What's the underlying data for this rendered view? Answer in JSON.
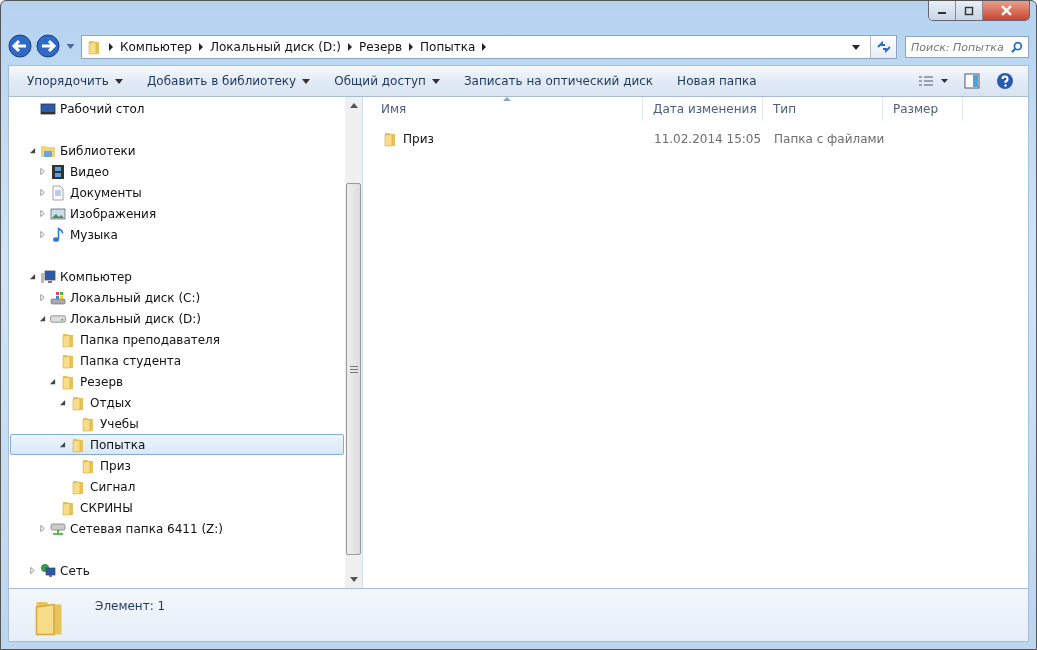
{
  "address_bar": {
    "path": [
      "Компьютер",
      "Локальный диск (D:)",
      "Резерв",
      "Попытка"
    ]
  },
  "search": {
    "placeholder": "Поиск: Попытка"
  },
  "toolbar": {
    "buttons": [
      {
        "label": "Упорядочить",
        "dropdown": true
      },
      {
        "label": "Добавить в библиотеку",
        "dropdown": true
      },
      {
        "label": "Общий доступ",
        "dropdown": true
      },
      {
        "label": "Записать на оптический диск",
        "dropdown": false
      },
      {
        "label": "Новая папка",
        "dropdown": false
      }
    ]
  },
  "sidebar": {
    "groups": [
      {
        "items": [
          {
            "label": "Рабочий стол",
            "kind": "desktop",
            "selected": false
          }
        ]
      },
      {
        "items": [
          {
            "label": "Библиотеки",
            "kind": "library",
            "expanded": true,
            "selected": false,
            "children": [
              {
                "label": "Видео",
                "kind": "video",
                "expanded": false,
                "selected": false
              },
              {
                "label": "Документы",
                "kind": "document",
                "expanded": false,
                "selected": false
              },
              {
                "label": "Изображения",
                "kind": "image",
                "expanded": false,
                "selected": false
              },
              {
                "label": "Музыка",
                "kind": "music",
                "expanded": false,
                "selected": false
              }
            ]
          }
        ]
      },
      {
        "items": [
          {
            "label": "Компьютер",
            "kind": "computer",
            "expanded": true,
            "selected": false,
            "children": [
              {
                "label": "Локальный диск (C:)",
                "kind": "system-drive",
                "expanded": false,
                "selected": false
              },
              {
                "label": "Локальный диск (D:)",
                "kind": "drive",
                "expanded": true,
                "selected": false,
                "children": [
                  {
                    "label": "Папка преподавателя",
                    "kind": "folder",
                    "selected": false
                  },
                  {
                    "label": "Папка студента",
                    "kind": "folder",
                    "selected": false
                  },
                  {
                    "label": "Резерв",
                    "kind": "folder",
                    "expanded": true,
                    "selected": false,
                    "children": [
                      {
                        "label": "Отдых",
                        "kind": "folder",
                        "expanded": true,
                        "selected": false,
                        "children": [
                          {
                            "label": "Учебы",
                            "kind": "folder",
                            "selected": false
                          }
                        ]
                      },
                      {
                        "label": "Попытка",
                        "kind": "folder",
                        "expanded": true,
                        "selected": true,
                        "children": [
                          {
                            "label": "Приз",
                            "kind": "folder",
                            "selected": false
                          }
                        ]
                      },
                      {
                        "label": "Сигнал",
                        "kind": "folder",
                        "selected": false
                      }
                    ]
                  },
                  {
                    "label": "СКРИНЫ",
                    "kind": "folder",
                    "selected": false
                  }
                ]
              },
              {
                "label": "Сетевая папка 6411 (Z:)",
                "kind": "network-drive",
                "expanded": false,
                "selected": false
              }
            ]
          }
        ]
      },
      {
        "items": [
          {
            "label": "Сеть",
            "kind": "network",
            "expanded": false,
            "selected": false
          }
        ]
      }
    ]
  },
  "file_list": {
    "columns": [
      {
        "label": "Имя",
        "sorted": true
      },
      {
        "label": "Дата изменения",
        "sorted": false
      },
      {
        "label": "Тип",
        "sorted": false
      },
      {
        "label": "Размер",
        "sorted": false
      }
    ],
    "rows": [
      {
        "name": "Приз",
        "kind": "folder",
        "date": "11.02.2014 15:05",
        "type": "Папка с файлами",
        "selected": false
      }
    ]
  },
  "status_bar": {
    "text": "Элемент: 1"
  }
}
